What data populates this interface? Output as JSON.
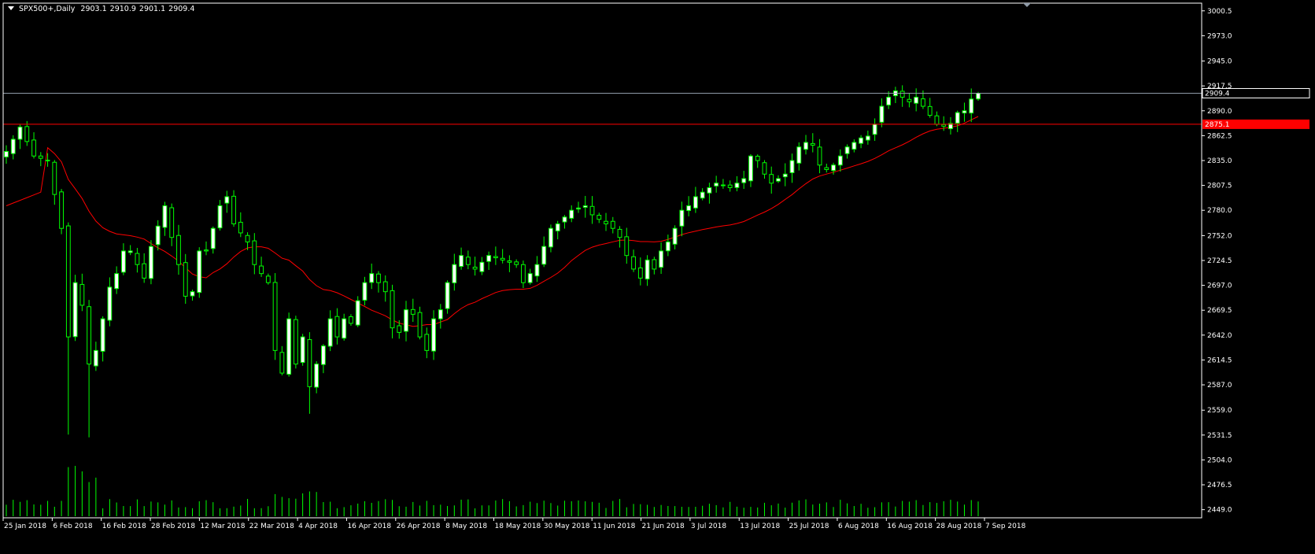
{
  "header": {
    "symbol": "SPX500+,Daily",
    "open": "2903.1",
    "high": "2910.9",
    "low": "2901.1",
    "close": "2909.4"
  },
  "colors": {
    "background": "#000000",
    "frame": "#ffffff",
    "bull_body": "#ffffff",
    "bear_body": "#000000",
    "wick": "#00ff00",
    "volume": "#00ff00",
    "moving_average": "#ff0000",
    "current_price_line": "#8f9aa7",
    "horizontal_line": "#ff0000",
    "axis_text": "#ffffff",
    "line_label_bg": "#ff0000"
  },
  "chart_data": {
    "type": "candlestick",
    "price_ticks": [
      "3000.5",
      "2973.0",
      "2945.0",
      "2917.5",
      "2890.0",
      "2862.5",
      "2835.0",
      "2807.5",
      "2780.0",
      "2752.0",
      "2724.5",
      "2697.0",
      "2669.5",
      "2642.0",
      "2614.5",
      "2587.0",
      "2559.0",
      "2531.5",
      "2504.0",
      "2476.5",
      "2449.0"
    ],
    "date_labels": [
      "25 Jan 2018",
      "6 Feb 2018",
      "16 Feb 2018",
      "28 Feb 2018",
      "12 Mar 2018",
      "22 Mar 2018",
      "4 Apr 2018",
      "16 Apr 2018",
      "26 Apr 2018",
      "8 May 2018",
      "18 May 2018",
      "30 May 2018",
      "11 Jun 2018",
      "21 Jun 2018",
      "3 Jul 2018",
      "13 Jul 2018",
      "25 Jul 2018",
      "6 Aug 2018",
      "16 Aug 2018",
      "28 Aug 2018",
      "7 Sep 2018"
    ],
    "ylim": [
      2440.0,
      3009.0
    ],
    "current_price_label": "2909.4",
    "current_price": 2909.4,
    "horizontal_line_label": "2875.1",
    "horizontal_line": 2875.1,
    "anchors": [
      {
        "i": 0,
        "c": 2845
      },
      {
        "i": 2,
        "c": 2872
      },
      {
        "i": 4,
        "c": 2840
      },
      {
        "i": 6,
        "c": 2835
      },
      {
        "i": 8,
        "c": 2760
      },
      {
        "i": 9,
        "c": 2640
      },
      {
        "i": 10,
        "c": 2700
      },
      {
        "i": 11,
        "c": 2675
      },
      {
        "i": 12,
        "c": 2610
      },
      {
        "i": 13,
        "c": 2625
      },
      {
        "i": 14,
        "c": 2660
      },
      {
        "i": 15,
        "c": 2695
      },
      {
        "i": 16,
        "c": 2710
      },
      {
        "i": 17,
        "c": 2735
      },
      {
        "i": 18,
        "c": 2735
      },
      {
        "i": 19,
        "c": 2720
      },
      {
        "i": 20,
        "c": 2705
      },
      {
        "i": 21,
        "c": 2740
      },
      {
        "i": 23,
        "c": 2785
      },
      {
        "i": 24,
        "c": 2750
      },
      {
        "i": 25,
        "c": 2720
      },
      {
        "i": 26,
        "c": 2685
      },
      {
        "i": 27,
        "c": 2690
      },
      {
        "i": 28,
        "c": 2735
      },
      {
        "i": 29,
        "c": 2735
      },
      {
        "i": 31,
        "c": 2785
      },
      {
        "i": 32,
        "c": 2795
      },
      {
        "i": 33,
        "c": 2765
      },
      {
        "i": 34,
        "c": 2755
      },
      {
        "i": 35,
        "c": 2745
      },
      {
        "i": 36,
        "c": 2720
      },
      {
        "i": 38,
        "c": 2700
      },
      {
        "i": 39,
        "c": 2625
      },
      {
        "i": 40,
        "c": 2600
      },
      {
        "i": 41,
        "c": 2660
      },
      {
        "i": 42,
        "c": 2610
      },
      {
        "i": 43,
        "c": 2640
      },
      {
        "i": 44,
        "c": 2585
      },
      {
        "i": 45,
        "c": 2610
      },
      {
        "i": 46,
        "c": 2630
      },
      {
        "i": 47,
        "c": 2660
      },
      {
        "i": 48,
        "c": 2640
      },
      {
        "i": 49,
        "c": 2660
      },
      {
        "i": 50,
        "c": 2655
      },
      {
        "i": 51,
        "c": 2680
      },
      {
        "i": 52,
        "c": 2700
      },
      {
        "i": 53,
        "c": 2710
      },
      {
        "i": 55,
        "c": 2690
      },
      {
        "i": 56,
        "c": 2650
      },
      {
        "i": 57,
        "c": 2645
      },
      {
        "i": 58,
        "c": 2670
      },
      {
        "i": 59,
        "c": 2665
      },
      {
        "i": 60,
        "c": 2640
      },
      {
        "i": 61,
        "c": 2625
      },
      {
        "i": 62,
        "c": 2660
      },
      {
        "i": 63,
        "c": 2670
      },
      {
        "i": 64,
        "c": 2700
      },
      {
        "i": 65,
        "c": 2720
      },
      {
        "i": 66,
        "c": 2730
      },
      {
        "i": 67,
        "c": 2720
      },
      {
        "i": 68,
        "c": 2715
      },
      {
        "i": 70,
        "c": 2730
      },
      {
        "i": 72,
        "c": 2725
      },
      {
        "i": 74,
        "c": 2720
      },
      {
        "i": 75,
        "c": 2700
      },
      {
        "i": 76,
        "c": 2710
      },
      {
        "i": 77,
        "c": 2720
      },
      {
        "i": 78,
        "c": 2740
      },
      {
        "i": 79,
        "c": 2760
      },
      {
        "i": 80,
        "c": 2765
      },
      {
        "i": 82,
        "c": 2780
      },
      {
        "i": 84,
        "c": 2785
      },
      {
        "i": 85,
        "c": 2775
      },
      {
        "i": 86,
        "c": 2770
      },
      {
        "i": 87,
        "c": 2765
      },
      {
        "i": 88,
        "c": 2760
      },
      {
        "i": 89,
        "c": 2750
      },
      {
        "i": 90,
        "c": 2730
      },
      {
        "i": 91,
        "c": 2715
      },
      {
        "i": 92,
        "c": 2705
      },
      {
        "i": 93,
        "c": 2725
      },
      {
        "i": 94,
        "c": 2715
      },
      {
        "i": 95,
        "c": 2735
      },
      {
        "i": 96,
        "c": 2745
      },
      {
        "i": 97,
        "c": 2760
      },
      {
        "i": 98,
        "c": 2780
      },
      {
        "i": 99,
        "c": 2785
      },
      {
        "i": 100,
        "c": 2795
      },
      {
        "i": 101,
        "c": 2800
      },
      {
        "i": 102,
        "c": 2805
      },
      {
        "i": 103,
        "c": 2810
      },
      {
        "i": 104,
        "c": 2808
      },
      {
        "i": 105,
        "c": 2805
      },
      {
        "i": 106,
        "c": 2810
      },
      {
        "i": 107,
        "c": 2815
      },
      {
        "i": 108,
        "c": 2840
      },
      {
        "i": 109,
        "c": 2835
      },
      {
        "i": 110,
        "c": 2820
      },
      {
        "i": 111,
        "c": 2810
      },
      {
        "i": 112,
        "c": 2815
      },
      {
        "i": 113,
        "c": 2820
      },
      {
        "i": 114,
        "c": 2835
      },
      {
        "i": 115,
        "c": 2850
      },
      {
        "i": 116,
        "c": 2855
      },
      {
        "i": 117,
        "c": 2852
      },
      {
        "i": 118,
        "c": 2830
      },
      {
        "i": 119,
        "c": 2825
      },
      {
        "i": 120,
        "c": 2830
      },
      {
        "i": 121,
        "c": 2840
      },
      {
        "i": 122,
        "c": 2850
      },
      {
        "i": 123,
        "c": 2855
      },
      {
        "i": 124,
        "c": 2860
      },
      {
        "i": 125,
        "c": 2862
      },
      {
        "i": 126,
        "c": 2875
      },
      {
        "i": 127,
        "c": 2895
      },
      {
        "i": 128,
        "c": 2905
      },
      {
        "i": 129,
        "c": 2912
      },
      {
        "i": 130,
        "c": 2905
      },
      {
        "i": 131,
        "c": 2900
      },
      {
        "i": 132,
        "c": 2905
      },
      {
        "i": 133,
        "c": 2895
      },
      {
        "i": 134,
        "c": 2885
      },
      {
        "i": 135,
        "c": 2875
      },
      {
        "i": 136,
        "c": 2873
      },
      {
        "i": 137,
        "c": 2876
      },
      {
        "i": 138,
        "c": 2888
      },
      {
        "i": 139,
        "c": 2890
      },
      {
        "i": 140,
        "c": 2903
      },
      {
        "i": 141,
        "c": 2909.4
      }
    ]
  }
}
